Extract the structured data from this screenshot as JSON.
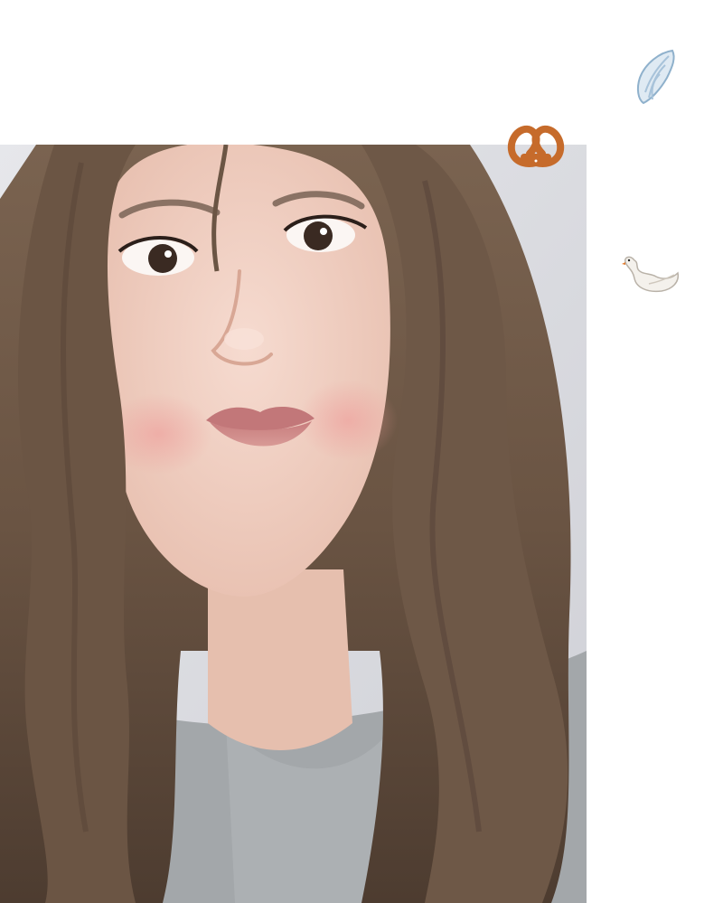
{
  "post": {
    "photo": {
      "subject": "selfie-portrait",
      "colors": {
        "wall": "#dcdde2",
        "hair": "#6e5846",
        "hair_shadow": "#4a3a2e",
        "skin": "#f0cfc2",
        "cheek": "#eeaaa6",
        "lips": "#c98786",
        "sweater": "#9fa3a6"
      }
    },
    "stickers": [
      {
        "icon": "wing-icon",
        "emoji": "🪽"
      },
      {
        "icon": "pretzel-icon",
        "emoji": "🥨"
      },
      {
        "icon": "swan-icon",
        "emoji": "🦢"
      }
    ],
    "background_color": "#ffffff"
  }
}
